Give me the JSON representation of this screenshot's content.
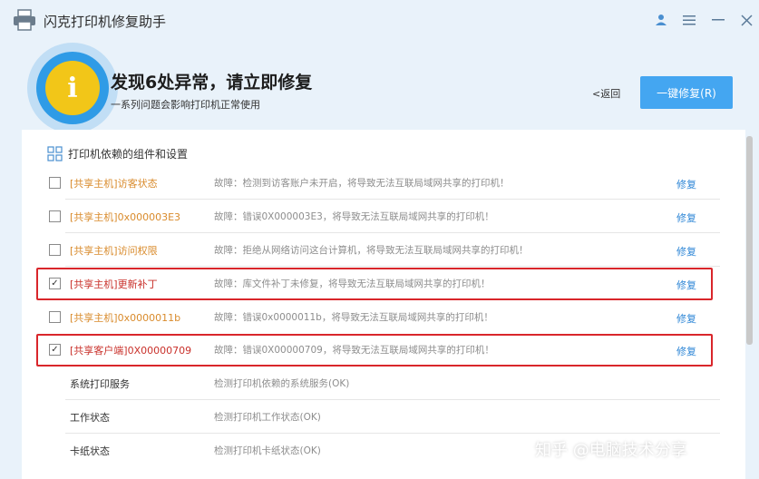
{
  "window": {
    "title": "闪克打印机修复助手"
  },
  "hero": {
    "title": "发现6处异常，请立即修复",
    "subtitle": "一系列问题会影响打印机正常使用",
    "back_label": "<返回",
    "fix_all_label": "一键修复(R)"
  },
  "panel": {
    "heading": "打印机依赖的组件和设置",
    "issues": [
      {
        "name": "[共享主机]访客状态",
        "desc": "故障：检测到访客账户未开启，将导致无法互联局域网共享的打印机！",
        "fix": "修复",
        "checked": false,
        "highlighted": false
      },
      {
        "name": "[共享主机]0x000003E3",
        "desc": "故障：错误0X000003E3，将导致无法互联局域网共享的打印机！",
        "fix": "修复",
        "checked": false,
        "highlighted": false
      },
      {
        "name": "[共享主机]访问权限",
        "desc": "故障：拒绝从网络访问这台计算机，将导致无法互联局域网共享的打印机！",
        "fix": "修复",
        "checked": false,
        "highlighted": false
      },
      {
        "name": "[共享主机]更新补丁",
        "desc": "故障：库文件补丁未修复，将导致无法互联局域网共享的打印机！",
        "fix": "修复",
        "checked": true,
        "highlighted": true
      },
      {
        "name": "[共享主机]0x0000011b",
        "desc": "故障：错误0x0000011b，将导致无法互联局域网共享的打印机！",
        "fix": "修复",
        "checked": false,
        "highlighted": false
      },
      {
        "name": "[共享客户端]0X00000709",
        "desc": "故障：错误0X00000709，将导致无法互联局域网共享的打印机！",
        "fix": "修复",
        "checked": true,
        "highlighted": true
      }
    ],
    "status_rows": [
      {
        "name": "系统打印服务",
        "desc": "检测打印机依赖的系统服务(OK)"
      },
      {
        "name": "工作状态",
        "desc": "检测打印机工作状态(OK)"
      },
      {
        "name": "卡纸状态",
        "desc": "检测打印机卡纸状态(OK)"
      }
    ]
  },
  "watermark": "知乎 @电脑技术分享",
  "colors": {
    "accent": "#44a6f1",
    "issue_text": "#d98b2c",
    "highlight_border": "#d9262b",
    "link": "#2d86d6"
  }
}
